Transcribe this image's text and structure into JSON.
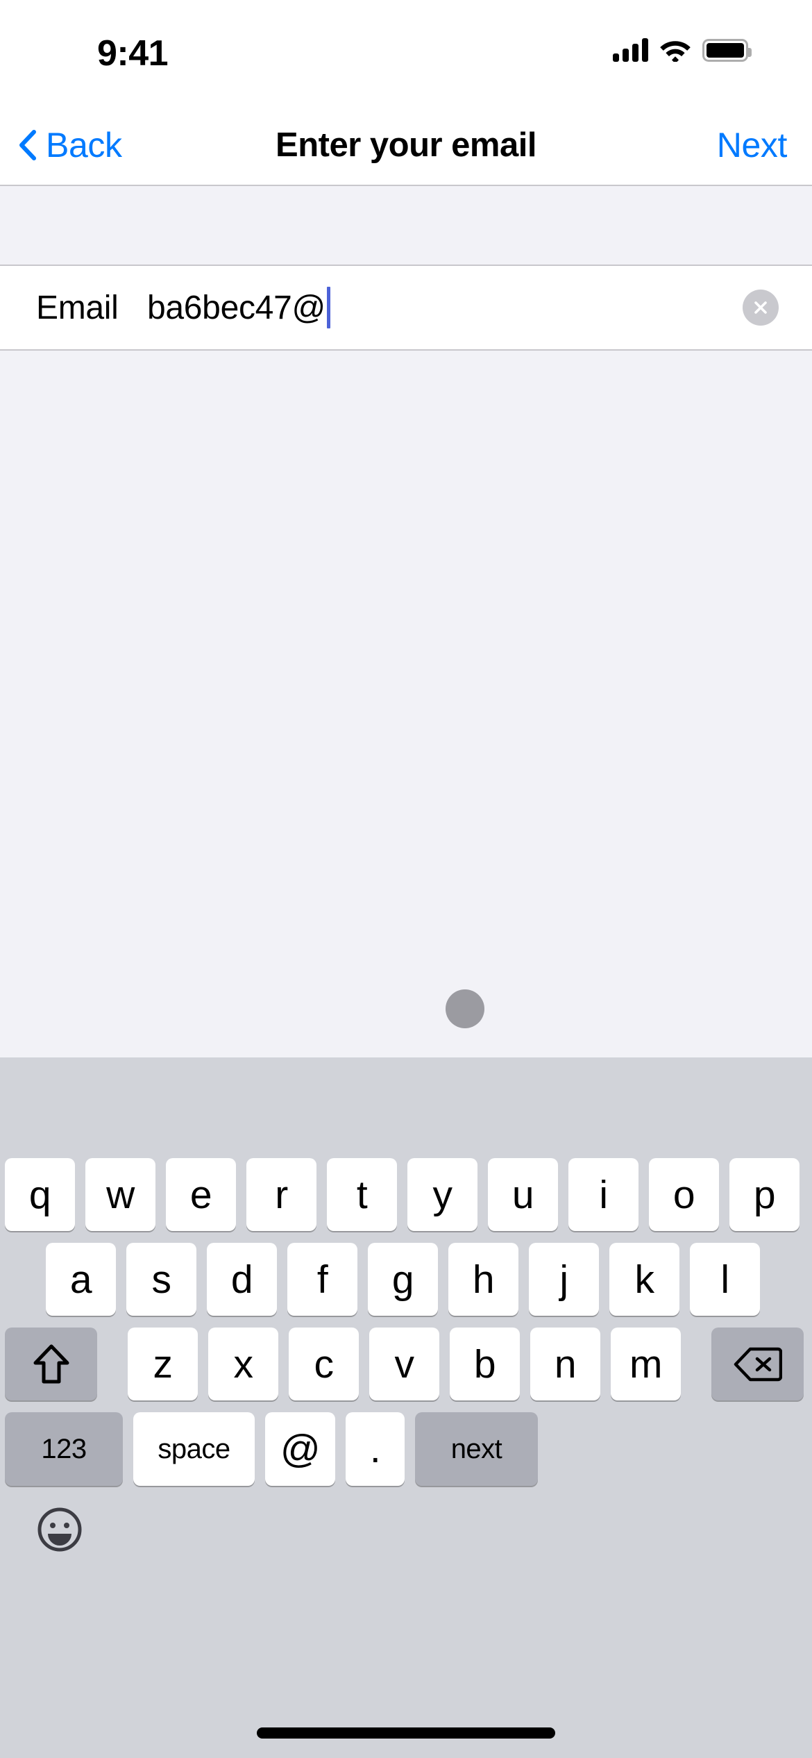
{
  "status_bar": {
    "time": "9:41",
    "cellular_icon": "signal-bars-icon",
    "wifi_icon": "wifi-icon",
    "battery_icon": "battery-full-icon"
  },
  "nav_bar": {
    "back_label": "Back",
    "back_icon": "chevron-left-icon",
    "title": "Enter your email",
    "next_label": "Next",
    "accent_color": "#007AFF"
  },
  "form": {
    "email_row": {
      "label": "Email",
      "value": "ba6bec47@",
      "placeholder": "Email",
      "clear_icon": "clear-circle-icon",
      "caret_color": "#4C62D8"
    }
  },
  "content": {
    "indicator": "loading-dot",
    "indicator_color": "#9B9BA1",
    "background_color": "#F2F2F7"
  },
  "keyboard": {
    "background_color": "#D1D3D9",
    "row1": [
      "q",
      "w",
      "e",
      "r",
      "t",
      "y",
      "u",
      "i",
      "o",
      "p"
    ],
    "row2": [
      "a",
      "s",
      "d",
      "f",
      "g",
      "h",
      "j",
      "k",
      "l"
    ],
    "row3_letters": [
      "z",
      "x",
      "c",
      "v",
      "b",
      "n",
      "m"
    ],
    "shift_icon": "shift-arrow-icon",
    "backspace_icon": "backspace-delete-icon",
    "row4": {
      "numbers_label": "123",
      "space_label": "space",
      "at_label": "@",
      "dot_label": ".",
      "return_label": "next"
    },
    "emoji_icon": "emoji-smiley-icon"
  },
  "home_indicator": "home-indicator-bar"
}
